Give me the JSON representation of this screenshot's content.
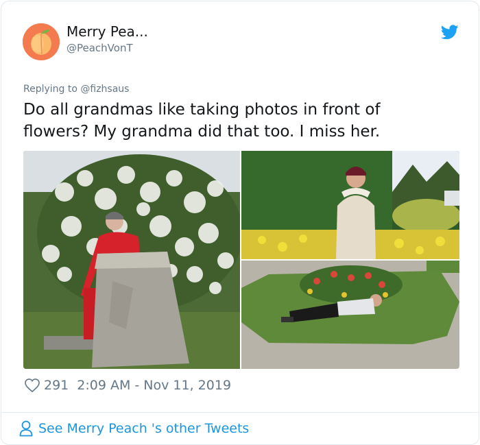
{
  "header": {
    "display_name": "Merry Pea...",
    "handle": "@PeachVonT",
    "avatar_icon": "peach-icon",
    "brand_icon": "twitter-bird-icon",
    "brand_color": "#1da1f2"
  },
  "tweet": {
    "reply_prefix": "Replying to",
    "reply_handle": "@fizhsaus",
    "text": "Do all grandmas like taking photos in front of flowers? My grandma did that too. I miss her.",
    "media": [
      {
        "alt": "Grandma in red tracksuit by a stone pillar in front of a white flowering bush"
      },
      {
        "alt": "Grandma in beige coat in front of a hedge and yellow flowers"
      },
      {
        "alt": "Grandma lying on a grass bed with flowers"
      }
    ]
  },
  "meta": {
    "heart_icon": "heart-icon",
    "likes": "291",
    "timestamp": "2:09 AM - Nov 11, 2019"
  },
  "footer": {
    "person_icon": "person-icon",
    "label": "See Merry Peach 's other Tweets"
  }
}
